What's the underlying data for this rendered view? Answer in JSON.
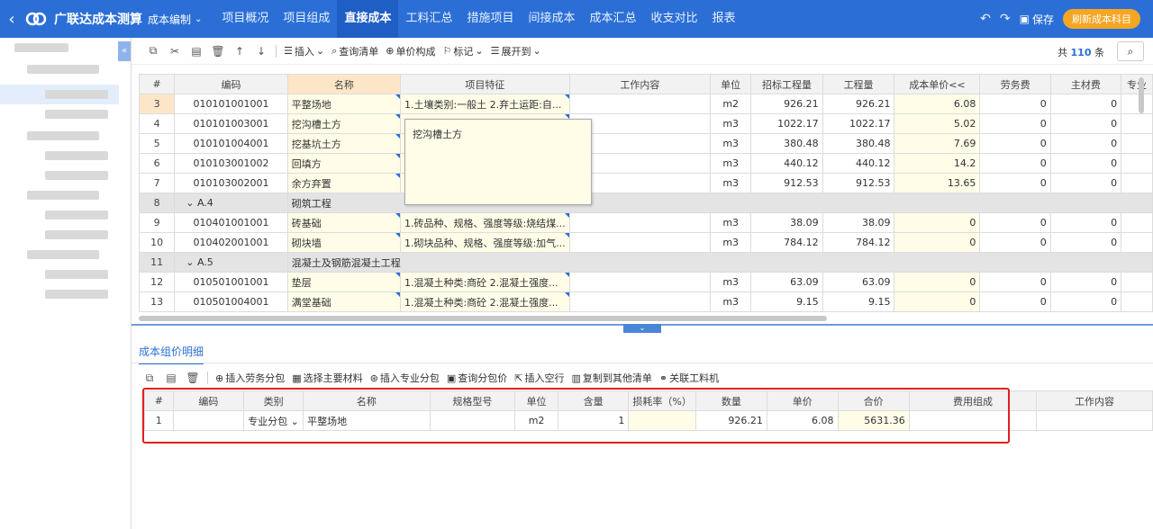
{
  "app": {
    "title": "广联达成本测算",
    "subtitle": "成本编制"
  },
  "nav": [
    "项目概况",
    "项目组成",
    "直接成本",
    "工料汇总",
    "措施项目",
    "间接成本",
    "成本汇总",
    "收支对比",
    "报表"
  ],
  "top_actions": {
    "save": "保存",
    "refresh": "刷新成本科目"
  },
  "toolbar": {
    "insert": "插入",
    "query": "查询清单",
    "unit_price": "单价构成",
    "mark": "标记",
    "expand": "展开到"
  },
  "count": {
    "prefix": "共",
    "value": "110",
    "suffix": "条"
  },
  "grid": {
    "headers": [
      "#",
      "编码",
      "名称",
      "项目特征",
      "工作内容",
      "单位",
      "招标工程量",
      "工程量",
      "成本单价<<",
      "劳务费",
      "主材费",
      "专业"
    ],
    "rows": [
      {
        "no": "3",
        "code": "010101001001",
        "name": "平整场地",
        "feature": "1.土壤类别:一般土 2.弃土运距:自...",
        "unit": "m2",
        "bid": "926.21",
        "qty": "926.21",
        "price": "6.08",
        "labor": "0",
        "mat": "0",
        "group": false
      },
      {
        "no": "4",
        "code": "010101003001",
        "name": "挖沟槽土方",
        "feature": "",
        "unit": "m3",
        "bid": "1022.17",
        "qty": "1022.17",
        "price": "5.02",
        "labor": "0",
        "mat": "0",
        "group": false
      },
      {
        "no": "5",
        "code": "010101004001",
        "name": "挖基坑土方",
        "feature": "",
        "unit": "m3",
        "bid": "380.48",
        "qty": "380.48",
        "price": "7.69",
        "labor": "0",
        "mat": "0",
        "group": false
      },
      {
        "no": "6",
        "code": "010103001002",
        "name": "回填方",
        "feature": "",
        "unit": "m3",
        "bid": "440.12",
        "qty": "440.12",
        "price": "14.2",
        "labor": "0",
        "mat": "0",
        "group": false
      },
      {
        "no": "7",
        "code": "010103002001",
        "name": "余方弃置",
        "feature": "",
        "unit": "m3",
        "bid": "912.53",
        "qty": "912.53",
        "price": "13.65",
        "labor": "0",
        "mat": "0",
        "group": false
      },
      {
        "no": "8",
        "code": "A.4",
        "name": "砌筑工程",
        "feature": "",
        "unit": "",
        "bid": "",
        "qty": "",
        "price": "",
        "labor": "",
        "mat": "",
        "group": true
      },
      {
        "no": "9",
        "code": "010401001001",
        "name": "砖基础",
        "feature": "1.砖品种、规格、强度等级:烧结煤...",
        "unit": "m3",
        "bid": "38.09",
        "qty": "38.09",
        "price": "0",
        "labor": "0",
        "mat": "0",
        "group": false
      },
      {
        "no": "10",
        "code": "010402001001",
        "name": "砌块墙",
        "feature": "1.砌块品种、规格、强度等级:加气...",
        "unit": "m3",
        "bid": "784.12",
        "qty": "784.12",
        "price": "0",
        "labor": "0",
        "mat": "0",
        "group": false
      },
      {
        "no": "11",
        "code": "A.5",
        "name": "混凝土及钢筋混凝土工程",
        "feature": "",
        "unit": "",
        "bid": "",
        "qty": "",
        "price": "",
        "labor": "",
        "mat": "",
        "group": true
      },
      {
        "no": "12",
        "code": "010501001001",
        "name": "垫层",
        "feature": "1.混凝土种类:商砼 2.混凝土强度...",
        "unit": "m3",
        "bid": "63.09",
        "qty": "63.09",
        "price": "0",
        "labor": "0",
        "mat": "0",
        "group": false
      },
      {
        "no": "13",
        "code": "010501004001",
        "name": "满堂基础",
        "feature": "1.混凝土种类:商砼 2.混凝土强度...",
        "unit": "m3",
        "bid": "9.15",
        "qty": "9.15",
        "price": "0",
        "labor": "0",
        "mat": "0",
        "group": false
      }
    ]
  },
  "tooltip": "挖沟槽土方",
  "detail": {
    "tab": "成本组价明细",
    "toolbar": [
      "插入劳务分包",
      "选择主要材料",
      "插入专业分包",
      "查询分包价",
      "插入空行",
      "复制到其他清单",
      "关联工料机"
    ],
    "headers": [
      "#",
      "编码",
      "类别",
      "名称",
      "规格型号",
      "单位",
      "含量",
      "损耗率（%）",
      "数量",
      "单价",
      "合价",
      "费用组成",
      "工作内容"
    ],
    "row": {
      "no": "1",
      "code": "",
      "type": "专业分包",
      "name": "平整场地",
      "spec": "",
      "unit": "m2",
      "content": "1",
      "loss": "",
      "qty": "926.21",
      "price": "6.08",
      "total": "5631.36",
      "fee": "",
      "work": ""
    }
  }
}
